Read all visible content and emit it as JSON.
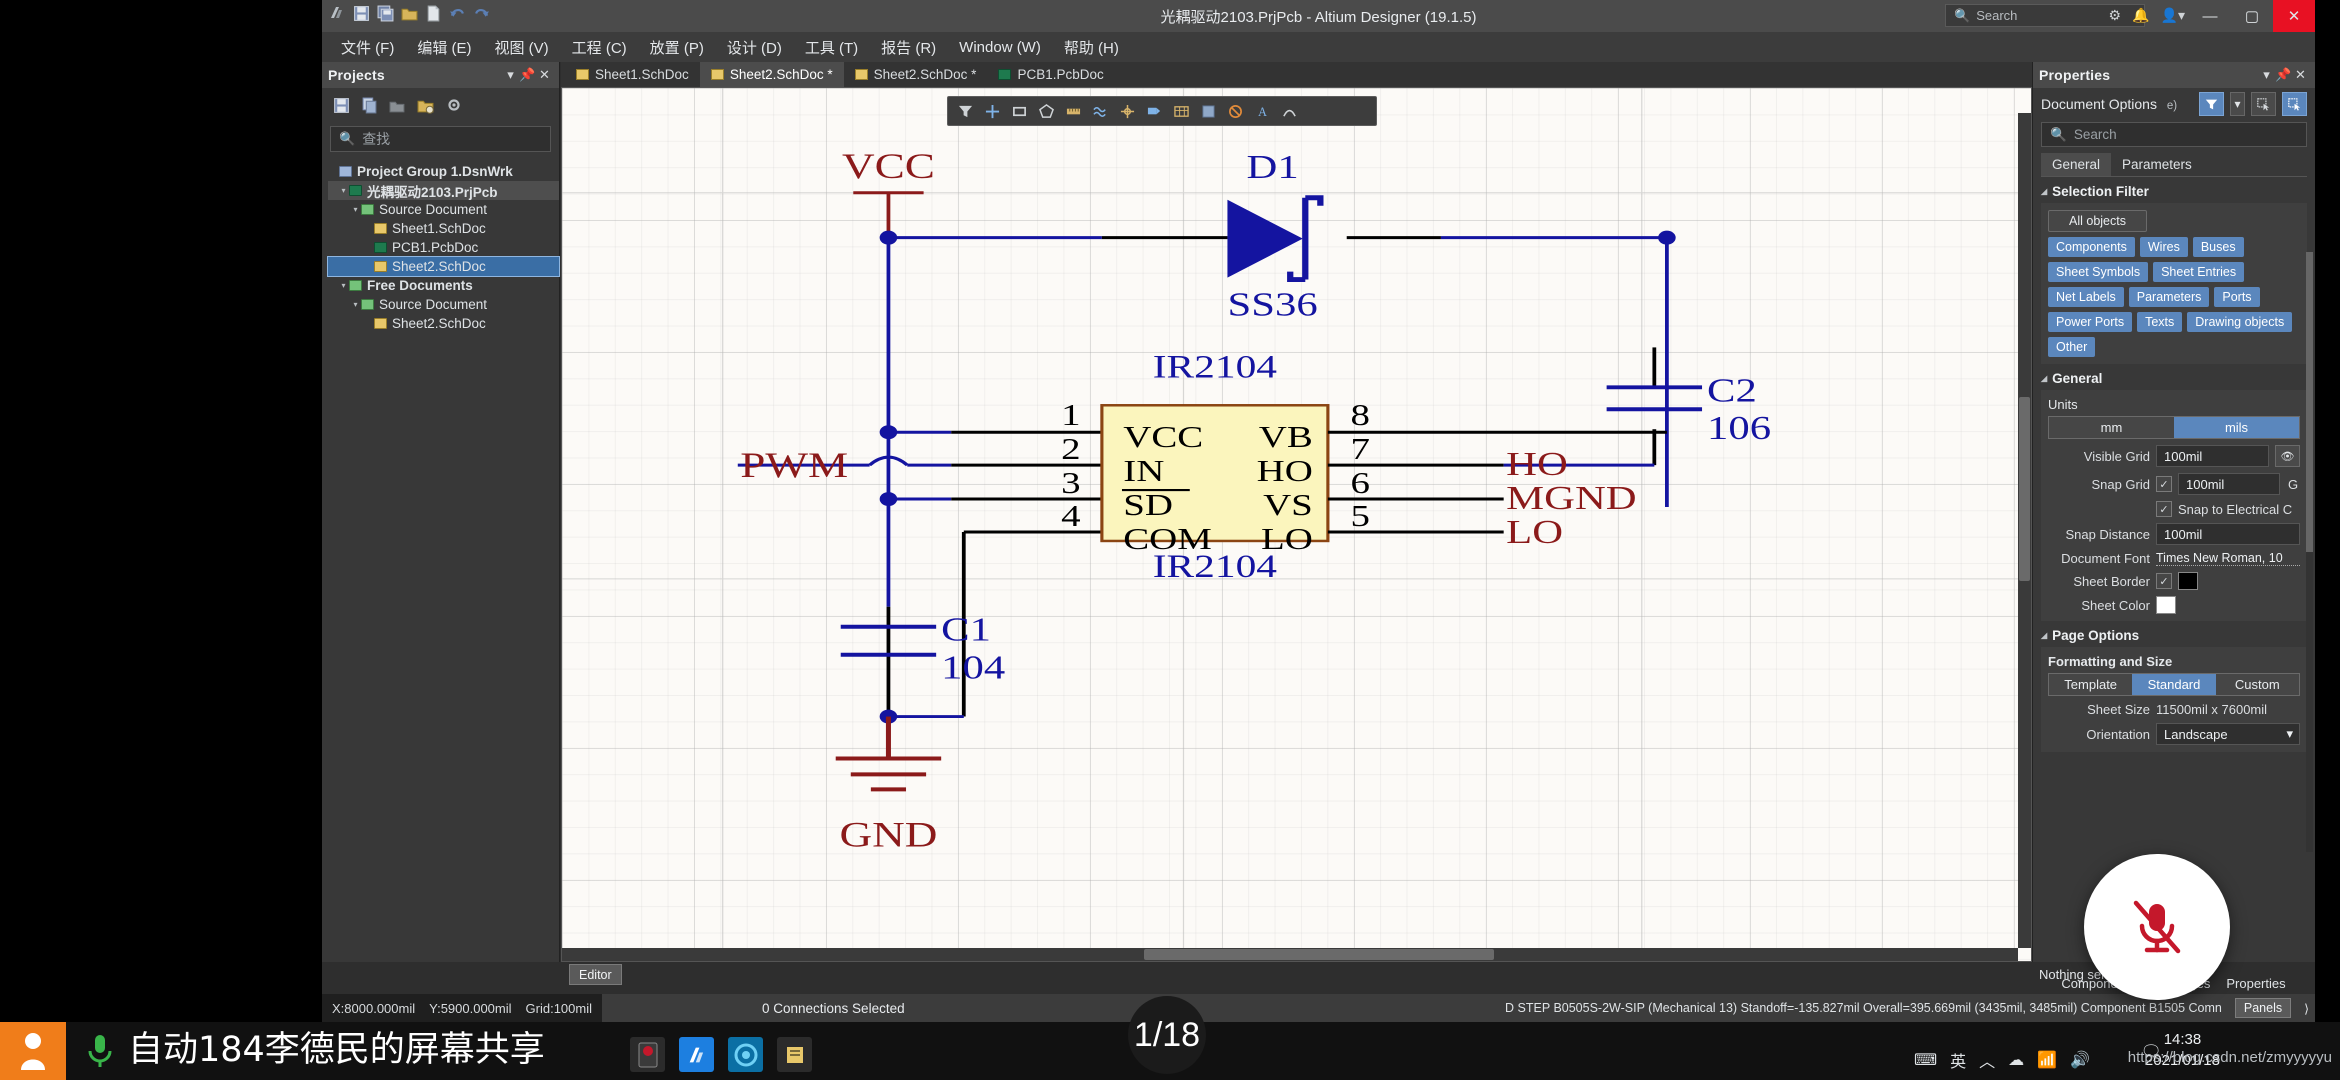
{
  "window": {
    "title": "光耦驱动2103.PrjPcb - Altium Designer (19.1.5)",
    "search_placeholder": "Search",
    "minimize": "—",
    "maximize": "▢",
    "close": "✕",
    "quick_access": [
      "undo-icon",
      "save-icon",
      "save-all-icon",
      "open-icon",
      "new-icon",
      "back-icon",
      "forward-icon"
    ]
  },
  "menubar": {
    "items": [
      {
        "label": "文件 (F)",
        "name": "menu-file"
      },
      {
        "label": "编辑 (E)",
        "name": "menu-edit"
      },
      {
        "label": "视图 (V)",
        "name": "menu-view"
      },
      {
        "label": "工程 (C)",
        "name": "menu-project"
      },
      {
        "label": "放置 (P)",
        "name": "menu-place"
      },
      {
        "label": "设计 (D)",
        "name": "menu-design"
      },
      {
        "label": "工具 (T)",
        "name": "menu-tools"
      },
      {
        "label": "报告 (R)",
        "name": "menu-reports"
      },
      {
        "label": "Window (W)",
        "name": "menu-window"
      },
      {
        "label": "帮助 (H)",
        "name": "menu-help"
      }
    ]
  },
  "projects_panel": {
    "title": "Projects",
    "header_buttons": [
      "chevron-down-icon",
      "pin-icon",
      "close-icon"
    ],
    "toolbar_icons": [
      "save-icon",
      "copy-icon",
      "compile-icon",
      "open-project-icon",
      "gear-icon"
    ],
    "search_placeholder": "查找",
    "tree": [
      {
        "label": "Project Group 1.DsnWrk",
        "indent": 0,
        "icon": "blue",
        "arrow": "",
        "state": "normal"
      },
      {
        "label": "光耦驱动2103.PrjPcb",
        "indent": 1,
        "icon": "green",
        "arrow": "▾",
        "state": "sel-dark"
      },
      {
        "label": "Source Document",
        "indent": 2,
        "icon": "folder",
        "arrow": "▾",
        "state": "normal"
      },
      {
        "label": "Sheet1.SchDoc",
        "indent": 3,
        "icon": "yellow",
        "arrow": "",
        "state": "normal"
      },
      {
        "label": "PCB1.PcbDoc",
        "indent": 3,
        "icon": "green",
        "arrow": "",
        "state": "normal"
      },
      {
        "label": "Sheet2.SchDoc",
        "indent": 3,
        "icon": "yellow",
        "arrow": "",
        "state": "sel-blue"
      },
      {
        "label": "Free Documents",
        "indent": 1,
        "icon": "folder",
        "arrow": "▾",
        "state": "normal"
      },
      {
        "label": "Source Document",
        "indent": 2,
        "icon": "folder",
        "arrow": "▾",
        "state": "normal"
      },
      {
        "label": "Sheet2.SchDoc",
        "indent": 3,
        "icon": "yellow",
        "arrow": "",
        "state": "normal"
      }
    ]
  },
  "doc_tabs": [
    {
      "label": "Sheet1.SchDoc",
      "icon": "yellow",
      "active": false
    },
    {
      "label": "Sheet2.SchDoc *",
      "icon": "yellow",
      "active": true
    },
    {
      "label": "Sheet2.SchDoc *",
      "icon": "yellow",
      "active": false
    },
    {
      "label": "PCB1.PcbDoc",
      "icon": "green",
      "active": false
    }
  ],
  "schematic_toolbar": {
    "tools": [
      "filter-icon",
      "crosshair-icon",
      "rectangle-icon",
      "polygon-icon",
      "ruler-icon",
      "wave-icon",
      "snap-icon",
      "net-label-icon",
      "table-icon",
      "sheet-icon",
      "no-erc-icon",
      "text-icon",
      "arc-icon"
    ]
  },
  "schematic": {
    "labels": {
      "vcc": "VCC",
      "gnd": "GND",
      "pwm": "PWM",
      "d1_designator": "D1",
      "d1_value": "SS36",
      "u1_top": "IR2104",
      "u1_bottom": "IR2104",
      "c1_designator": "C1",
      "c1_value": "104",
      "c2_designator": "C2",
      "c2_value": "106",
      "ho": "HO",
      "mgnd": "MGND",
      "lo": "LO"
    },
    "ic_pins_left": [
      {
        "num": "1",
        "name": "VCC"
      },
      {
        "num": "2",
        "name": "IN"
      },
      {
        "num": "3",
        "name": "SD"
      },
      {
        "num": "4",
        "name": "COM"
      }
    ],
    "ic_pins_right": [
      {
        "num": "8",
        "name": "VB"
      },
      {
        "num": "7",
        "name": "HO"
      },
      {
        "num": "6",
        "name": "VS"
      },
      {
        "num": "5",
        "name": "LO"
      }
    ],
    "colors": {
      "wire": "#1414a0",
      "pin": "#000000",
      "power": "#8b1a1a",
      "ic_fill": "#fbf5bd",
      "ic_border": "#8b4513",
      "designator": "#1414a0",
      "netlabel": "#8b1a1a",
      "diode": "#1414a0"
    }
  },
  "editor_button": "Editor",
  "properties_panel": {
    "title": "Properties",
    "header_buttons": [
      "chevron-down-icon",
      "pin-icon",
      "close-icon"
    ],
    "document_options_label": "Document Options",
    "document_options_suffix": "e)",
    "search_placeholder": "Search",
    "tabs": [
      {
        "label": "General",
        "active": true
      },
      {
        "label": "Parameters",
        "active": false
      }
    ],
    "selection_filter": {
      "title": "Selection Filter",
      "all_objects": "All objects",
      "chips": [
        "Components",
        "Wires",
        "Buses",
        "Sheet Symbols",
        "Sheet Entries",
        "Net Labels",
        "Parameters",
        "Ports",
        "Power Ports",
        "Texts",
        "Drawing objects",
        "Other"
      ]
    },
    "general": {
      "title": "General",
      "units_label": "Units",
      "units": [
        {
          "label": "mm",
          "active": false
        },
        {
          "label": "mils",
          "active": true
        }
      ],
      "visible_grid_label": "Visible Grid",
      "visible_grid_value": "100mil",
      "snap_grid_label": "Snap Grid",
      "snap_grid_value": "100mil",
      "snap_grid_checked": true,
      "snap_grid_hotkey": "G",
      "snap_electrical_label": "Snap to Electrical C",
      "snap_electrical_checked": true,
      "snap_distance_label": "Snap Distance",
      "snap_distance_value": "100mil",
      "document_font_label": "Document Font",
      "document_font_value": "Times New Roman, 10",
      "sheet_border_label": "Sheet Border",
      "sheet_border_checked": true,
      "sheet_border_color": "#000000",
      "sheet_color_label": "Sheet Color",
      "sheet_color": "#ffffff"
    },
    "page_options": {
      "title": "Page Options",
      "formatting_label": "Formatting and Size",
      "format_buttons": [
        {
          "label": "Template",
          "active": false
        },
        {
          "label": "Standard",
          "active": true
        },
        {
          "label": "Custom",
          "active": false
        }
      ],
      "sheet_size_label": "Sheet Size",
      "sheet_size_value": "11500mil  x  7600mil",
      "orientation_label": "Orientation",
      "orientation_value": "Landscape"
    },
    "status": "Nothing selected",
    "bottom_tabs": [
      "Components",
      "Messages",
      "Properties"
    ]
  },
  "statusbar": {
    "coords_x": "X:8000.000mil",
    "coords_y": "Y:5900.000mil",
    "grid": "Grid:100mil",
    "connections": "0 Connections Selected",
    "info": "D STEP B0505S-2W-SIP (Mechanical 13)   Standoff=-135.827mil   Overall=395.669mil   (3435mil, 3485mil)   Component B1505 Comn",
    "panels_button": "Panels"
  },
  "page_indicator": "1/18",
  "taskbar": {
    "share_text": "自动184李德民的屏幕共享",
    "apps": [
      {
        "name": "recorder-app",
        "color": "#3a3a3a",
        "glyph": "●"
      },
      {
        "name": "altium-app",
        "color": "#1d7fe0",
        "glyph": "▲"
      },
      {
        "name": "browser-app",
        "color": "#1a9cd8",
        "glyph": "◉"
      },
      {
        "name": "files-app",
        "color": "#e8c86a",
        "glyph": "▤"
      }
    ],
    "tray": [
      "keyboard-icon",
      "ime-english",
      "caret-up-icon",
      "cloud-icon",
      "network-icon",
      "volume-icon"
    ],
    "ime_label": "英",
    "clock_time": "14:38",
    "clock_date": "2021/01/18",
    "url": "https://blog.csdn.net/zmyyyyyu"
  }
}
